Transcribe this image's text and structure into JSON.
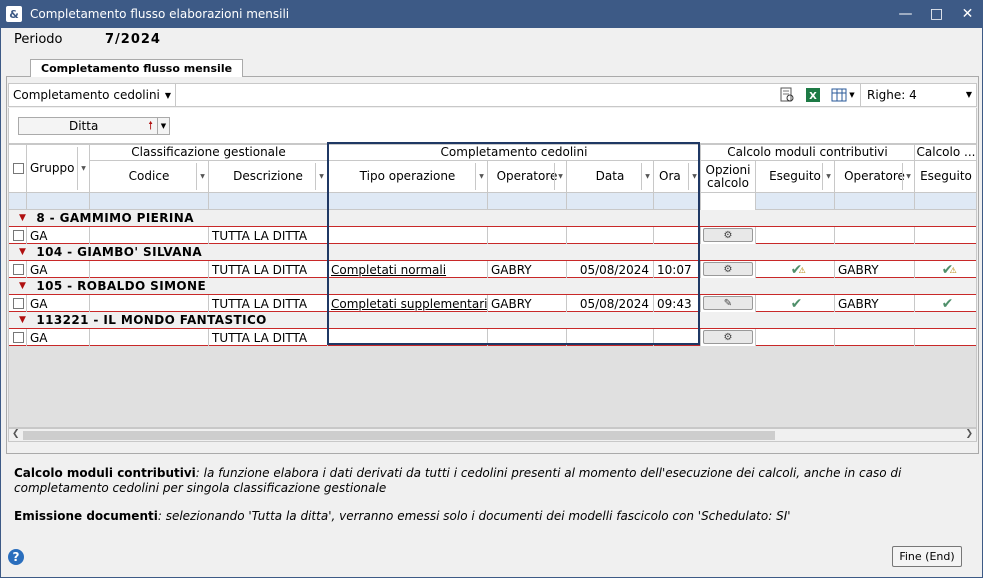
{
  "window": {
    "title": "Completamento flusso elaborazioni mensili"
  },
  "periodo": {
    "label": "Periodo",
    "value": "7/2024"
  },
  "tab": {
    "label": "Completamento flusso mensile"
  },
  "toolbar": {
    "combo_label": "Completamento cedolini",
    "righe_label": "Righe: 4"
  },
  "grouping": {
    "field": "Ditta"
  },
  "headers": {
    "gruppo": "Gruppo",
    "classificazione": "Classificazione gestionale",
    "codice": "Codice",
    "descrizione": "Descrizione",
    "completamento": "Completamento cedolini",
    "tipo_operazione": "Tipo operazione",
    "operatore": "Operatore",
    "data": "Data",
    "ora": "Ora",
    "opzioni_calcolo": "Opzioni calcolo",
    "calcolo_moduli": "Calcolo moduli contributivi",
    "eseguito": "Eseguito",
    "operatore2": "Operatore",
    "calcolo_more": "Calcolo ...",
    "eseguito2": "Eseguito"
  },
  "groups": [
    {
      "title": "8 - GAMMIMO PIERINA",
      "row": {
        "gruppo": "GA",
        "codice": "",
        "descrizione": "TUTTA LA DITTA",
        "tipo": "",
        "operatore": "",
        "data": "",
        "ora": "",
        "eseguito": "",
        "operatore2": "",
        "eseguito2": ""
      }
    },
    {
      "title": "104 - GIAMBO' SILVANA",
      "row": {
        "gruppo": "GA",
        "codice": "",
        "descrizione": "TUTTA LA DITTA",
        "tipo": "Completati normali",
        "operatore": "GABRY",
        "data": "05/08/2024",
        "ora": "10:07",
        "eseguito": "✔",
        "operatore2": "GABRY",
        "eseguito2": "✔"
      }
    },
    {
      "title": "105 - ROBALDO SIMONE",
      "row": {
        "gruppo": "GA",
        "codice": "",
        "descrizione": "TUTTA LA DITTA",
        "tipo": "Completati supplementari",
        "operatore": "GABRY",
        "data": "05/08/2024",
        "ora": "09:43",
        "eseguito": "✔",
        "operatore2": "GABRY",
        "eseguito2": "✔"
      }
    },
    {
      "title": "113221 - IL MONDO FANTASTICO",
      "row": {
        "gruppo": "GA",
        "codice": "",
        "descrizione": "TUTTA LA DITTA",
        "tipo": "",
        "operatore": "",
        "data": "",
        "ora": "",
        "eseguito": "",
        "operatore2": "",
        "eseguito2": ""
      }
    }
  ],
  "notes": {
    "n1_title": "Calcolo moduli contributivi",
    "n1_text": ": la funzione elabora i dati derivati da tutti i cedolini presenti al momento dell'esecuzione dei calcoli, anche in caso di completamento cedolini per singola classificazione gestionale",
    "n2_title": "Emissione documenti",
    "n2_text": ": selezionando 'Tutta la ditta', verranno emessi solo i documenti dei modelli fascicolo con 'Schedulato: SI'"
  },
  "footer": {
    "fine_label": "Fine (End)"
  },
  "colors": {
    "titlebar": "#3d5a86",
    "highlight": "#1f3864",
    "group_line": "#c82828",
    "check": "#4f8f6a"
  }
}
